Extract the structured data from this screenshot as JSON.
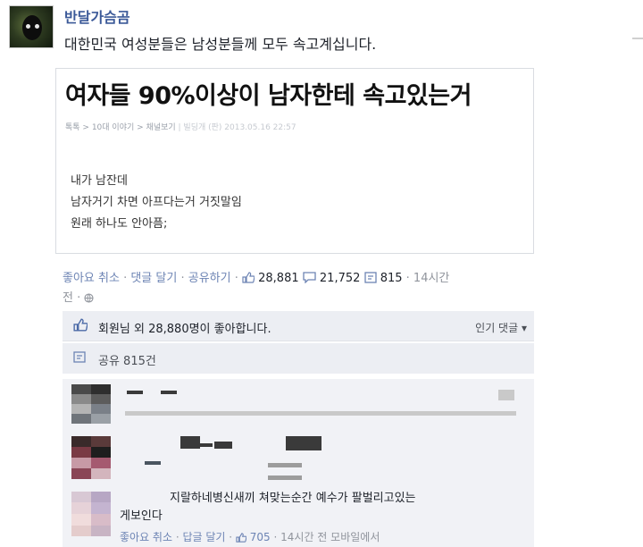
{
  "post": {
    "author": "반달가슴곰",
    "text": "대한민국 여성분들은 남성분들께 모두 속고계십니다."
  },
  "shared_card": {
    "headline": "여자들 90%이상이 남자한테 속고있는거",
    "breadcrumb": "톡톡 > 10대 이야기 > 채널보기",
    "breadcrumb_rest": "| 빌딩개 (판) 2013.05.16 22:57",
    "body_lines": [
      "내가 남잔데",
      "남자거기 차면 아프다는거 거짓말임",
      "원래 하나도 안아픔;"
    ]
  },
  "actions": {
    "like": "좋아요 취소",
    "comment": "댓글 달기",
    "share": "공유하기",
    "like_count": "28,881",
    "comment_count": "21,752",
    "share_count": "815",
    "time": "14시간",
    "time2": "전"
  },
  "likes_summary": {
    "text": "회원님 외 28,880명이 좋아합니다.",
    "popular": "인기 댓글"
  },
  "shares_summary": {
    "text": "공유 815건"
  },
  "comment3": {
    "text_line1": "지랄하네병신새끼 쳐맞는순간 예수가 팔벌리고있는",
    "text_line2": "게보인다",
    "like": "좋아요 취소",
    "reply": "답글 달기",
    "like_count": "705",
    "meta": "14시간 전 모바일에서"
  },
  "colors": {
    "link_blue": "#3b5998",
    "action_blue": "#6d84b4",
    "meta_gray": "#90949c",
    "panel_bg": "#eceef3"
  }
}
